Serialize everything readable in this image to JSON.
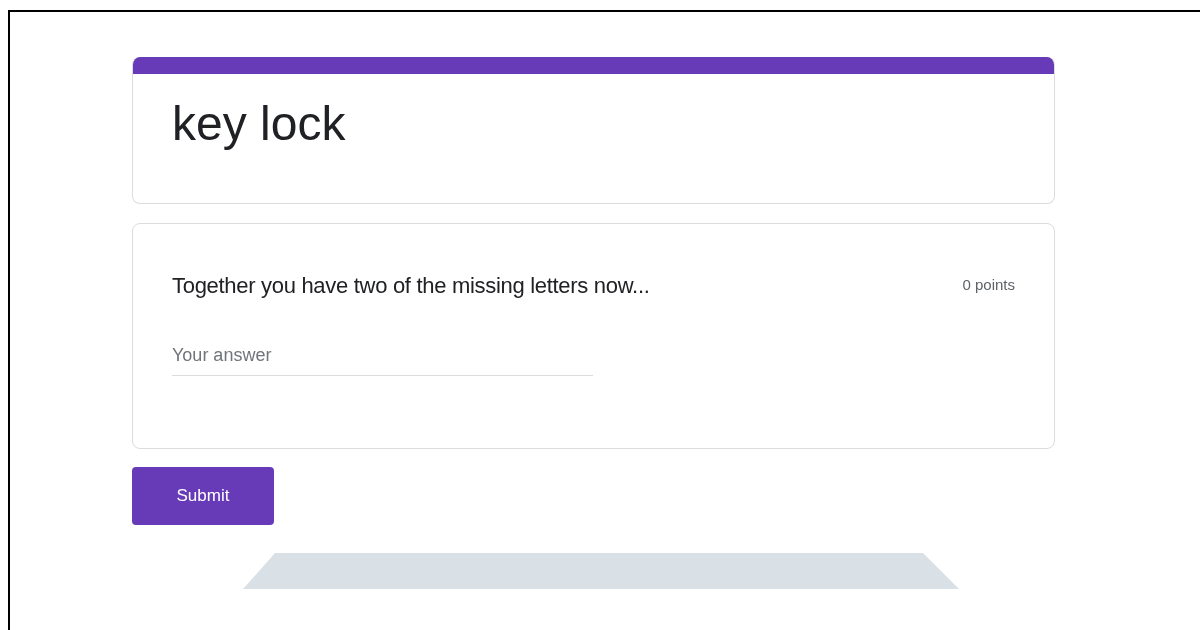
{
  "form": {
    "title": "key lock"
  },
  "question": {
    "text": "Together you have two of the missing letters now...",
    "points": "0 points",
    "placeholder": "Your answer"
  },
  "submit": {
    "label": "Submit"
  }
}
